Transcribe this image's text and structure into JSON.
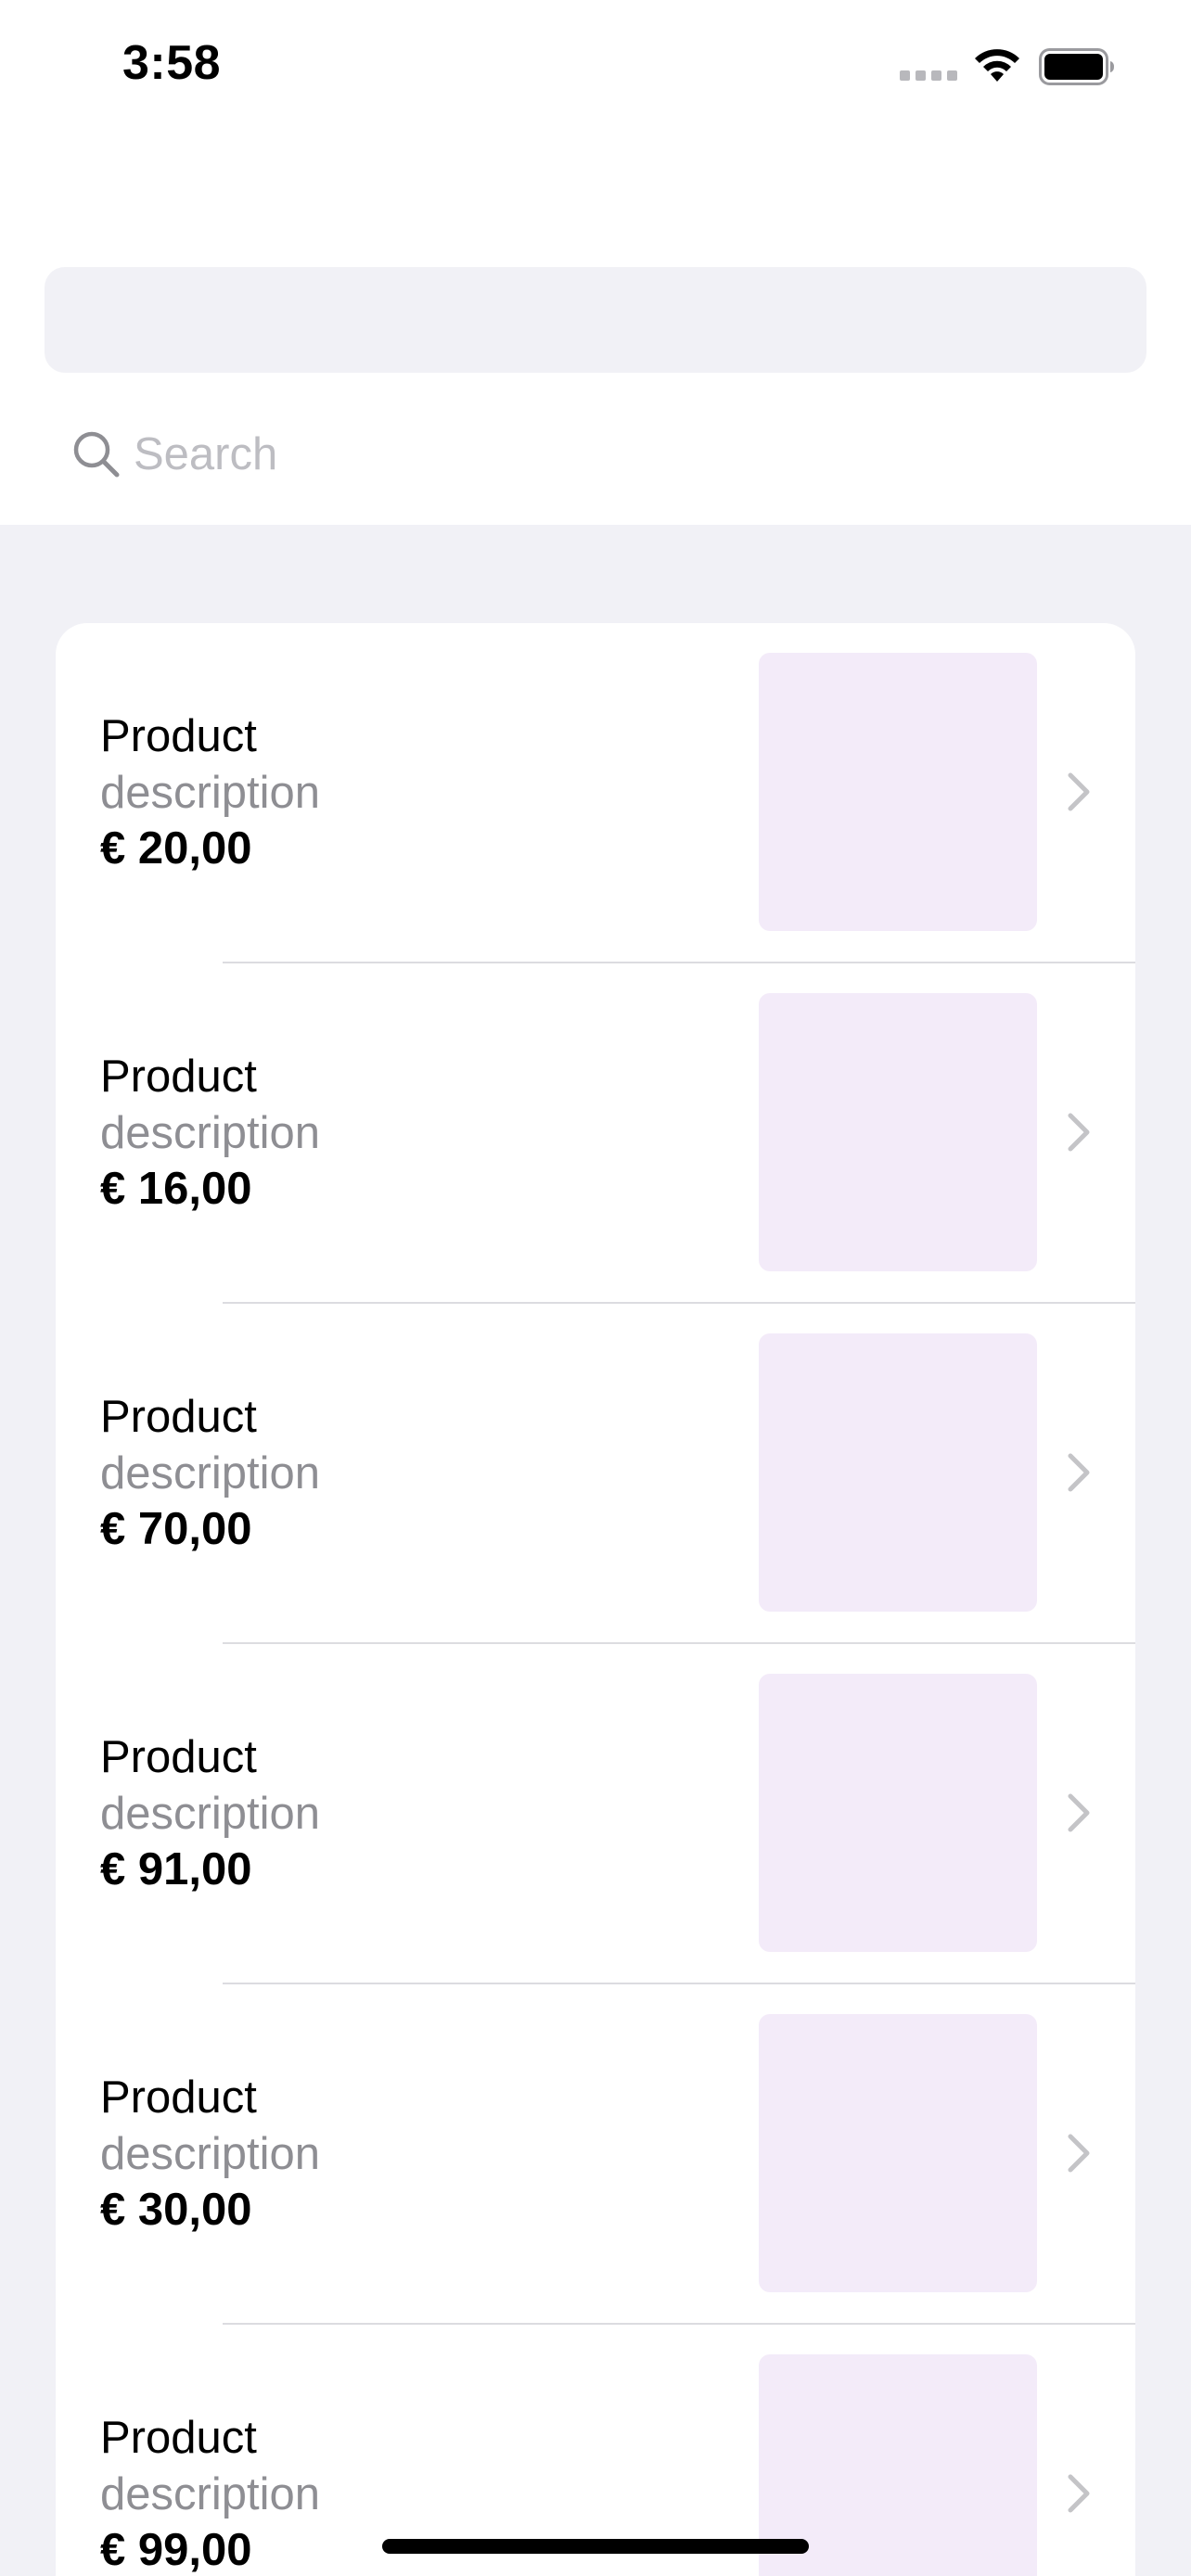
{
  "status_bar": {
    "time": "3:58",
    "icons": [
      "signal-icon",
      "wifi-icon",
      "battery-icon"
    ]
  },
  "search": {
    "placeholder": "Search",
    "value": "",
    "icon": "search-icon"
  },
  "products": [
    {
      "title": "Product",
      "description": "description",
      "price": "€ 20,00"
    },
    {
      "title": "Product",
      "description": "description",
      "price": "€ 16,00"
    },
    {
      "title": "Product",
      "description": "description",
      "price": "€ 70,00"
    },
    {
      "title": "Product",
      "description": "description",
      "price": "€ 91,00"
    },
    {
      "title": "Product",
      "description": "description",
      "price": "€ 30,00"
    },
    {
      "title": "Product",
      "description": "description",
      "price": "€ 99,00"
    }
  ],
  "colors": {
    "grouped_background": "#f1f1f6",
    "image_placeholder": "#f3ebf9",
    "secondary_text": "#8e8e93",
    "chevron": "#c4c4c7"
  }
}
